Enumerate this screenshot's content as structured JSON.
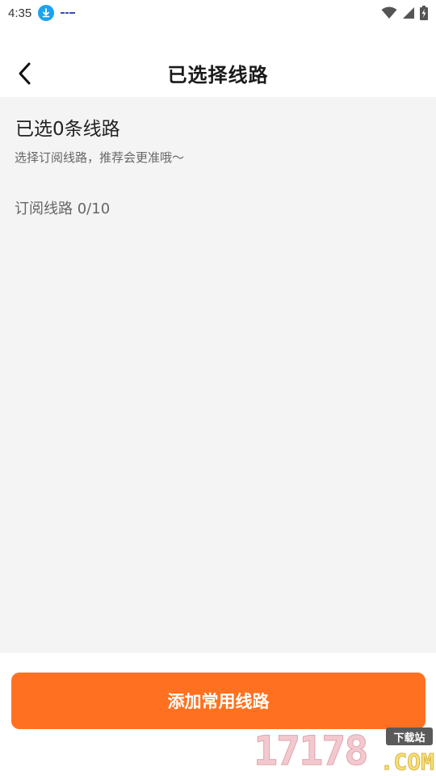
{
  "status_bar": {
    "time": "4:35"
  },
  "header": {
    "title": "已选择线路"
  },
  "content": {
    "selected_count_text": "已选0条线路",
    "hint": "选择订阅线路，推荐会更准哦～",
    "subscription_label": "订阅线路 0/10"
  },
  "footer": {
    "add_button_label": "添加常用线路"
  },
  "watermark": {
    "number": "17178",
    "tag": "下载站",
    "domain": ".COM"
  },
  "colors": {
    "accent": "#ff7120",
    "content_bg": "#f4f4f4",
    "download_icon": "#1aa3f0"
  },
  "icons": {
    "back": "chevron-left-icon",
    "download": "download-icon",
    "wifi": "wifi-icon",
    "signal": "signal-icon",
    "battery": "battery-charging-icon"
  }
}
